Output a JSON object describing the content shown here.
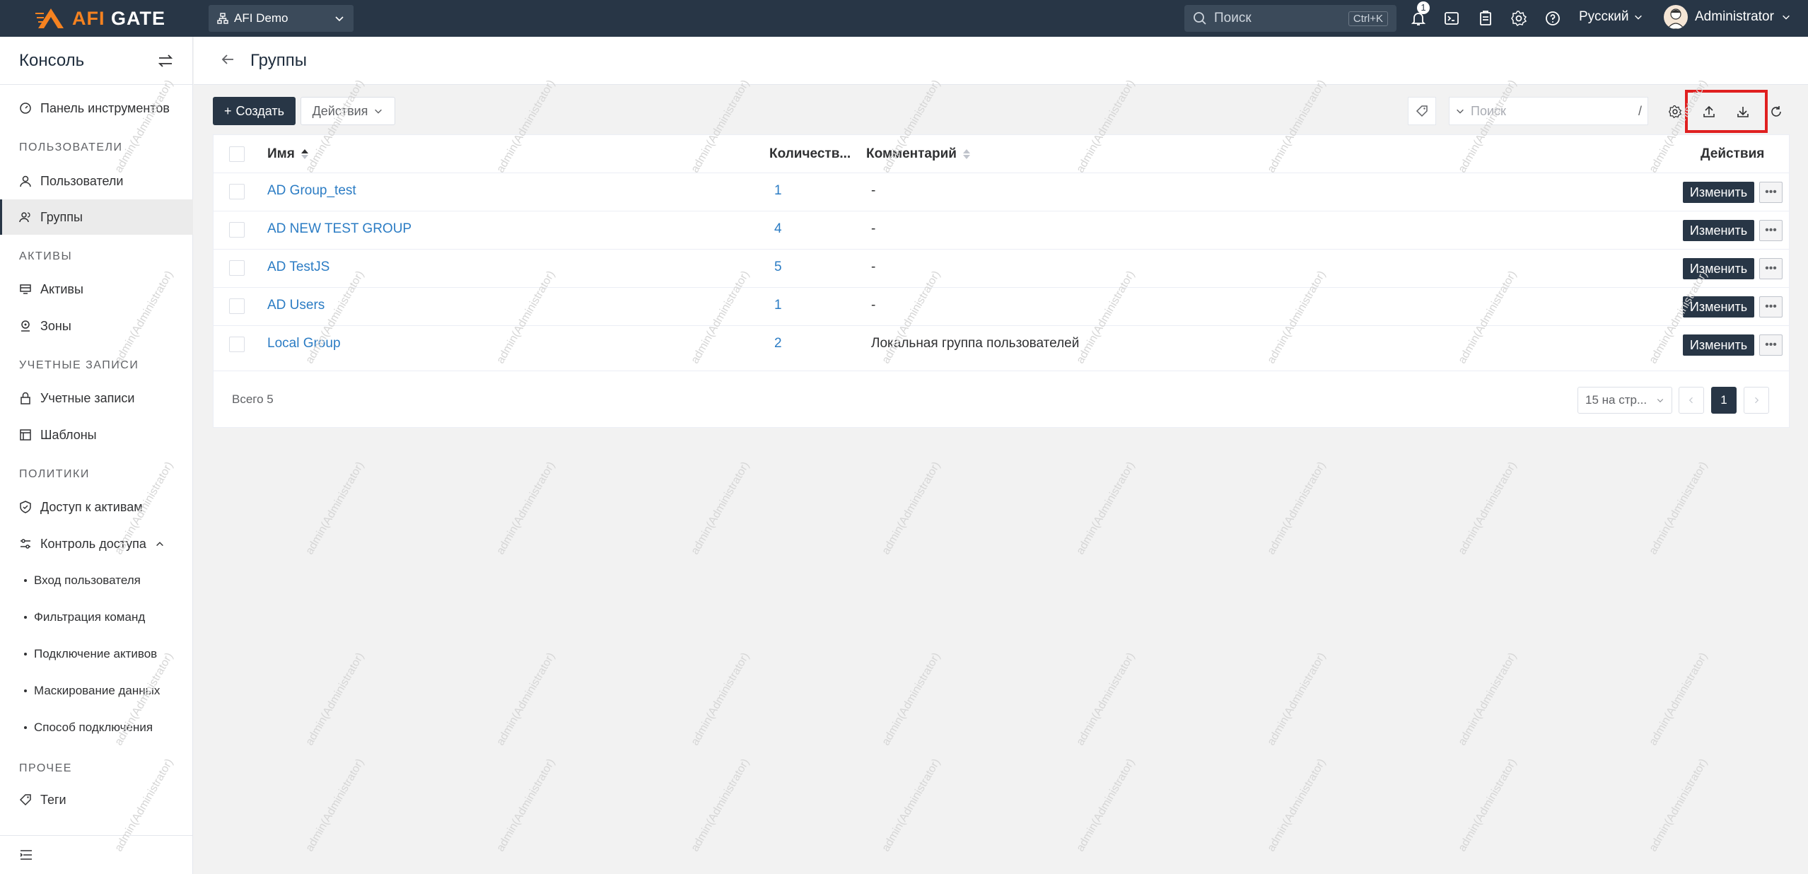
{
  "app": {
    "logo_main": "AFI",
    "logo_rest": " GATE",
    "org": "AFI Demo",
    "search_placeholder": "Поиск",
    "search_shortcut": "Ctrl+K",
    "notifications_count": "1",
    "language": "Русский",
    "user": "Administrator"
  },
  "sidebar": {
    "title": "Консоль",
    "dashboard": "Панель инструментов",
    "sections": {
      "users": "ПОЛЬЗОВАТЕЛИ",
      "assets": "АКТИВЫ",
      "accounts": "УЧЕТНЫЕ ЗАПИСИ",
      "policies": "ПОЛИТИКИ",
      "other": "ПРОЧЕЕ"
    },
    "items": {
      "users": "Пользователи",
      "groups": "Группы",
      "assets": "Активы",
      "zones": "Зоны",
      "accounts": "Учетные записи",
      "templates": "Шаблоны",
      "asset_access": "Доступ к активам",
      "access_control": "Контроль доступа",
      "tags": "Теги"
    },
    "sub_items": {
      "user_login": "Вход пользователя",
      "command_filter": "Фильтрация команд",
      "asset_connect": "Подключение активов",
      "data_masking": "Маскирование данных",
      "connect_method": "Способ подключения"
    }
  },
  "page": {
    "title": "Группы",
    "create_label": "Создать",
    "actions_label": "Действия",
    "search_placeholder": "Поиск",
    "search_shortcut": "/"
  },
  "table": {
    "headers": {
      "name": "Имя",
      "count": "Количеств...",
      "comment": "Комментарий",
      "actions": "Действия"
    },
    "edit_label": "Изменить",
    "more_label": "•••",
    "rows": [
      {
        "name": "AD Group_test",
        "count": "1",
        "comment": "-"
      },
      {
        "name": "AD NEW TEST GROUP",
        "count": "4",
        "comment": "-"
      },
      {
        "name": "AD TestJS",
        "count": "5",
        "comment": "-"
      },
      {
        "name": "AD Users",
        "count": "1",
        "comment": "-"
      },
      {
        "name": "Local Group",
        "count": "2",
        "comment": "Локальная группа пользователей"
      }
    ]
  },
  "pager": {
    "total": "Всего 5",
    "per_page": "15 на стр...",
    "current": "1"
  },
  "watermark": "admin(Administrator)",
  "colors": {
    "primary": "#283646",
    "accent": "#f58220",
    "link": "#2b7cc4",
    "highlight": "#e02020"
  }
}
